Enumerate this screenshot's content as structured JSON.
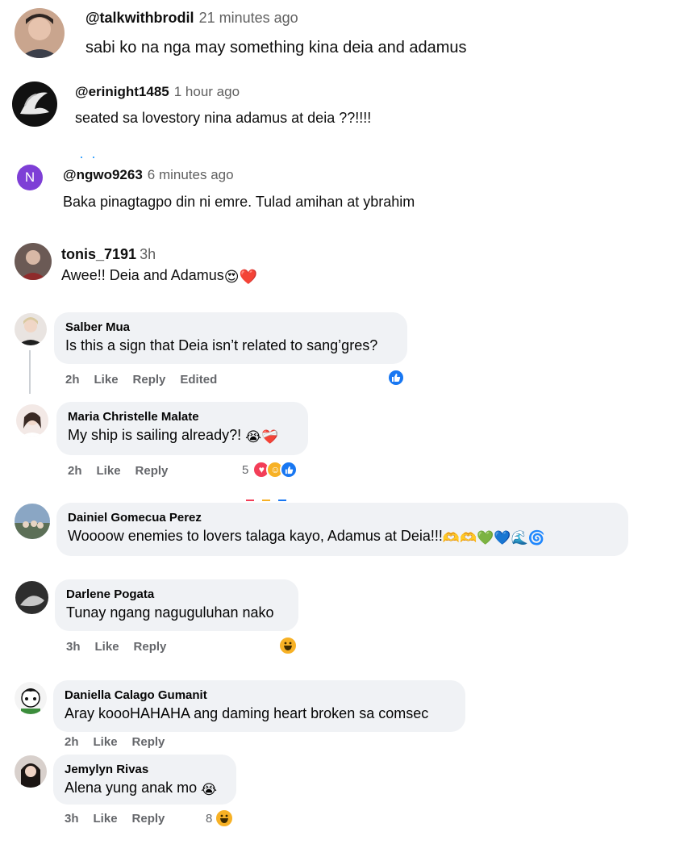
{
  "comments_yt": [
    {
      "handle": "@talkwithbrodil",
      "time": "21 minutes ago",
      "text": "sabi ko na nga may something kina deia and adamus"
    },
    {
      "handle": "@erinight1485",
      "time": "1 hour ago",
      "text": "seated sa lovestory nina adamus at deia ??!!!!"
    },
    {
      "handle": "@ngwo9263",
      "time": "6 minutes ago",
      "text": "Baka pinagtagpo din ni emre. Tulad amihan at ybrahim",
      "avatar_letter": "N"
    }
  ],
  "comment_ig": {
    "handle": "tonis_7191",
    "time": "3h",
    "text": "Awee!! Deia and Adamus",
    "emojis": "😍❤️"
  },
  "comments_fb": [
    {
      "name": "Salber Mua",
      "text": "Is this a sign that Deia isn’t related to sang’gres?",
      "time": "2h",
      "like": "Like",
      "reply": "Reply",
      "edited": "Edited"
    },
    {
      "name": "Maria Christelle Malate",
      "text": "My ship is sailing already?!",
      "text_emojis": "😭❤️‍🩹",
      "time": "2h",
      "like": "Like",
      "reply": "Reply",
      "reaction_count": "5"
    },
    {
      "name": "Dainiel Gomecua Perez",
      "text": "Woooow enemies to lovers talaga kayo, Adamus at Deia!!!",
      "text_emojis": "🫶🫶💚💙🌊🌀"
    },
    {
      "name": "Darlene Pogata",
      "text": "Tunay ngang naguguluhan nako",
      "time": "3h",
      "like": "Like",
      "reply": "Reply"
    },
    {
      "name": "Daniella Calago Gumanit",
      "text": "Aray koooHAHAHA ang daming heart broken sa comsec",
      "time": "2h",
      "like": "Like",
      "reply": "Reply"
    },
    {
      "name": "Jemylyn Rivas",
      "text": "Alena yung anak mo",
      "text_emojis": "😭",
      "time": "3h",
      "like": "Like",
      "reply": "Reply",
      "reaction_count": "8"
    }
  ],
  "colors": {
    "fb_like": "#1877f2",
    "fb_love": "#f33e58",
    "yt_letter_avatar": "#7e3fd6"
  }
}
